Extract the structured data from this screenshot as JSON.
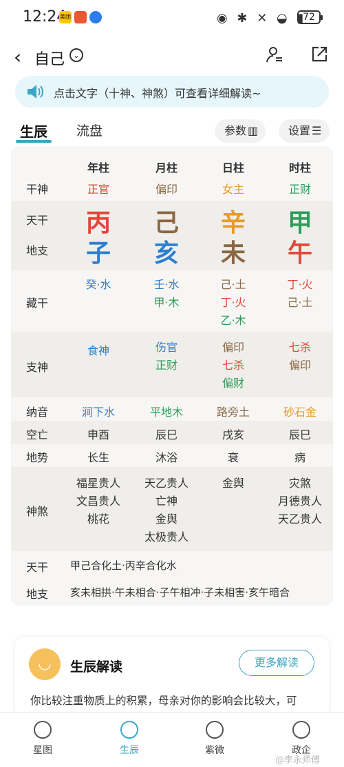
{
  "status": {
    "time": "12:24",
    "app1": "美团",
    "battery": "72"
  },
  "header": {
    "title": "自己",
    "back_icon": "chevron-left-icon",
    "dropdown_icon": "chevron-down-icon",
    "person_icon": "person-switch-icon",
    "share_icon": "share-icon"
  },
  "notice": {
    "text": "点击文字（十神、神煞）可查看详细解读~"
  },
  "tabs": {
    "active": "生辰",
    "inactive": "流盘",
    "params": "参数",
    "settings": "设置"
  },
  "chart": {
    "columns": [
      "年柱",
      "月柱",
      "日柱",
      "时柱"
    ],
    "labels": {
      "ganshen": "干神",
      "tiangan": "天干",
      "dizhi": "地支",
      "canggan": "藏干",
      "zhishen": "支神",
      "nayin": "纳音",
      "kongwang": "空亡",
      "dishi": "地势",
      "shensha": "神煞",
      "bottom_tiangan": "天干",
      "bottom_dizhi": "地支"
    },
    "ganshen": [
      "正官",
      "偏印",
      "女主",
      "正财"
    ],
    "tiangan": [
      "丙",
      "己",
      "辛",
      "甲"
    ],
    "dizhi": [
      "子",
      "亥",
      "未",
      "午"
    ],
    "canggan": [
      [
        "癸·水"
      ],
      [
        "壬·水",
        "甲·木"
      ],
      [
        "己·土",
        "丁·火",
        "乙·木"
      ],
      [
        "丁·火",
        "己·土"
      ]
    ],
    "zhishen": [
      [
        "食神"
      ],
      [
        "伤官",
        "正财"
      ],
      [
        "偏印",
        "七杀",
        "偏财"
      ],
      [
        "七杀",
        "偏印"
      ]
    ],
    "nayin": [
      "涧下水",
      "平地木",
      "路旁土",
      "砂石金"
    ],
    "kongwang": [
      "申酉",
      "辰巳",
      "戌亥",
      "辰巳"
    ],
    "dishi": [
      "长生",
      "沐浴",
      "衰",
      "病"
    ],
    "shensha": [
      [
        "福星贵人",
        "文昌贵人",
        "桃花"
      ],
      [
        "天乙贵人",
        "亡神",
        "金舆",
        "太极贵人"
      ],
      [
        "金舆"
      ],
      [
        "灾煞",
        "月德贵人",
        "天乙贵人"
      ]
    ],
    "relations": {
      "tiangan": "甲己合化土·丙辛合化水",
      "dizhi": "亥未相拱·午未相合·子午相冲·子未相害·亥午暗合"
    }
  },
  "card": {
    "title": "生辰解读",
    "button": "更多解读",
    "text": "你比较注重物质上的积累，母亲对你的影响会比较大，可"
  },
  "nav": [
    "星图",
    "生辰",
    "紫微",
    "政企"
  ],
  "watermark": "@李永师傅",
  "colors": {
    "accent": "#3aa7c4",
    "red": "#e0473a",
    "blue": "#2a7fd1",
    "green": "#2e9c5a",
    "brown": "#8a6844",
    "orange": "#e69a2d"
  }
}
